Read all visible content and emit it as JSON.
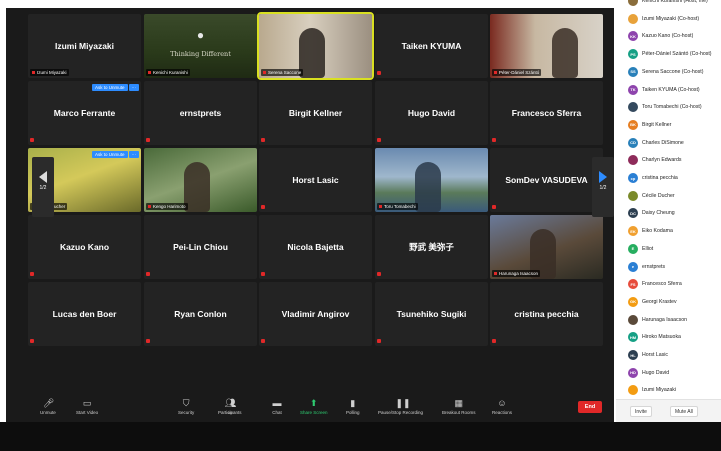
{
  "tiles": [
    {
      "name": "Izumi Miyazaki",
      "label": "Izumi Miyazaki"
    },
    {
      "name": "",
      "label": "Kenichi Kuranishi",
      "text_in_video": "Thinking Different"
    },
    {
      "name": "",
      "label": "Serena Saccone"
    },
    {
      "name": "Taiken KYUMA",
      "label": ""
    },
    {
      "name": "",
      "label": "Péter-Dániel Szántó"
    },
    {
      "name": "Marco Ferrante",
      "label": ""
    },
    {
      "name": "ernstprets",
      "label": ""
    },
    {
      "name": "Birgit Kellner",
      "label": ""
    },
    {
      "name": "Hugo David",
      "label": ""
    },
    {
      "name": "Francesco Sferra",
      "label": ""
    },
    {
      "name": "",
      "label": "Cécile Ducher"
    },
    {
      "name": "",
      "label": "Kengo Harimoto"
    },
    {
      "name": "Horst Lasic",
      "label": ""
    },
    {
      "name": "",
      "label": "Toru Tomabechi"
    },
    {
      "name": "SomDev VASUDEVA",
      "label": ""
    },
    {
      "name": "Kazuo Kano",
      "label": ""
    },
    {
      "name": "Pei-Lin Chiou",
      "label": ""
    },
    {
      "name": "Nicola Bajetta",
      "label": ""
    },
    {
      "name": "野武 美弥子",
      "label": ""
    },
    {
      "name": "",
      "label": "Harunaga Isaacson"
    },
    {
      "name": "Lucas den Boer",
      "label": ""
    },
    {
      "name": "Ryan Conlon",
      "label": ""
    },
    {
      "name": "Vladimir Angirov",
      "label": ""
    },
    {
      "name": "Tsunehiko Sugiki",
      "label": ""
    },
    {
      "name": "cristina pecchia",
      "label": ""
    }
  ],
  "ask_to_unmute": "Ask to Unmute",
  "ask_more": "···",
  "page_indicator": "1/2",
  "toolbar": {
    "unmute": "Unmute",
    "start_video": "Start Video",
    "security": "Security",
    "participants": "Participants",
    "participants_count": "40",
    "chat": "Chat",
    "share_screen": "Share Screen",
    "polling": "Polling",
    "pause_recording": "Pause/Stop Recording",
    "breakout_rooms": "Breakout Rooms",
    "reactions": "Reactions",
    "end": "End"
  },
  "participants": [
    {
      "initials": "",
      "name": "Kenichi Kuranishi (Host, me)",
      "color": "#8a6d3b"
    },
    {
      "initials": "",
      "name": "Izumi Miyazaki (Co-host)",
      "color": "#e8a23a"
    },
    {
      "initials": "KK",
      "name": "Kazuo Kano (Co-host)",
      "color": "#8e44ad"
    },
    {
      "initials": "PS",
      "name": "Péter-Dániel Szántó (Co-host)",
      "color": "#16a085"
    },
    {
      "initials": "SS",
      "name": "Serena Saccone (Co-host)",
      "color": "#2980b9"
    },
    {
      "initials": "TK",
      "name": "Taiken KYUMA (Co-host)",
      "color": "#8e44ad"
    },
    {
      "initials": "",
      "name": "Toru Tomabechi (Co-host)",
      "color": "#34495e"
    },
    {
      "initials": "BK",
      "name": "Birgit Kellner",
      "color": "#e67e22"
    },
    {
      "initials": "CD",
      "name": "Charles DiSimone",
      "color": "#2980b9"
    },
    {
      "initials": "",
      "name": "Charlyn Edwards",
      "color": "#8e2b5a"
    },
    {
      "initials": "cp",
      "name": "cristina pecchia",
      "color": "#2a7fd4"
    },
    {
      "initials": "",
      "name": "Cécile Ducher",
      "color": "#7a8a2a"
    },
    {
      "initials": "DC",
      "name": "Daisy Cheung",
      "color": "#2c3e50"
    },
    {
      "initials": "EK",
      "name": "Eiko Kodama",
      "color": "#f0a030"
    },
    {
      "initials": "E",
      "name": "Elliot",
      "color": "#27ae60"
    },
    {
      "initials": "e",
      "name": "ernstprets",
      "color": "#2a7fd4"
    },
    {
      "initials": "FS",
      "name": "Francesco Sferra",
      "color": "#e74c3c"
    },
    {
      "initials": "GK",
      "name": "Georgi Krastev",
      "color": "#f39c12"
    },
    {
      "initials": "",
      "name": "Harunaga Isaacson",
      "color": "#5a4a3a"
    },
    {
      "initials": "HM",
      "name": "Hiroko Matsuoka",
      "color": "#16a085"
    },
    {
      "initials": "HL",
      "name": "Horst Lasic",
      "color": "#2c3e50"
    },
    {
      "initials": "HD",
      "name": "Hugo David",
      "color": "#8e44ad"
    },
    {
      "initials": "",
      "name": "Izumi Miyazaki",
      "color": "#f39c12"
    }
  ],
  "panel_footer": {
    "invite": "Invite",
    "mute_all": "Mute All"
  },
  "colors": {
    "unmute_badge": "#2d8cff",
    "end_button": "#e02828",
    "active_border": "#d9e021"
  }
}
